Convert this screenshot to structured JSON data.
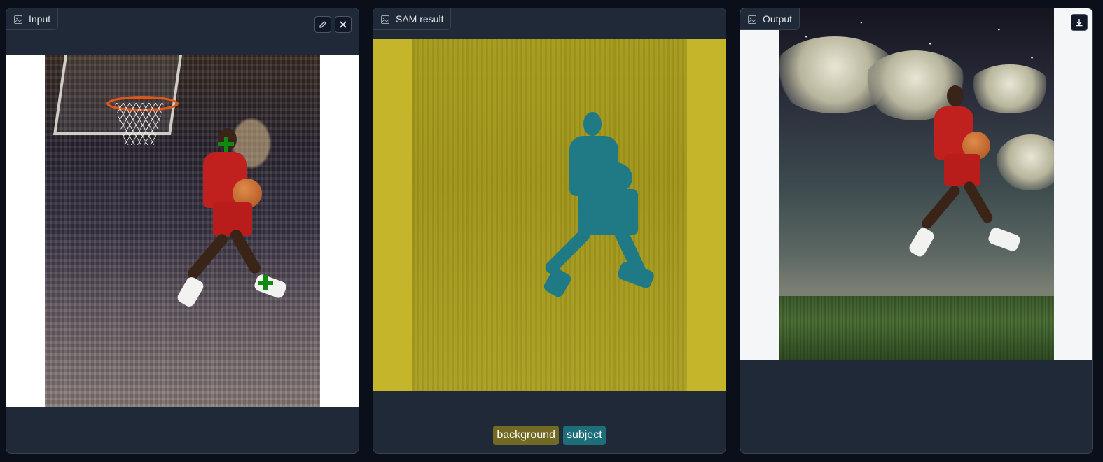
{
  "input_panel": {
    "label": "Input",
    "icon": "image-icon",
    "tools": [
      "edit-icon",
      "close-icon"
    ]
  },
  "sam_panel": {
    "label": "SAM result",
    "icon": "image-icon",
    "legend": [
      {
        "label": "background",
        "color": "#726a24"
      },
      {
        "label": "subject",
        "color": "#1e6e7a"
      }
    ]
  },
  "output_panel": {
    "label": "Output",
    "icon": "image-icon",
    "tools": [
      "download-icon"
    ]
  },
  "colors": {
    "app_background": "#0b0f19",
    "panel_background": "#1f2937",
    "panel_border": "#374151",
    "point_marker": "#118a11",
    "mask_background": "#a59a1c",
    "mask_subject": "#1f7a86"
  }
}
